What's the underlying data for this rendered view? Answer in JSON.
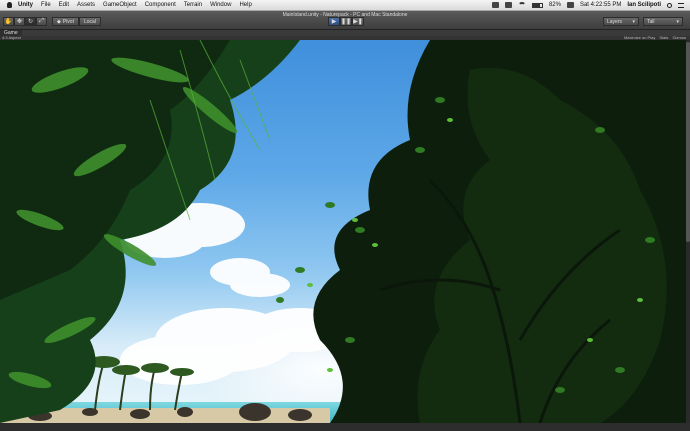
{
  "menubar": {
    "app": "Unity",
    "items": [
      "File",
      "Edit",
      "Assets",
      "GameObject",
      "Component",
      "Terrain",
      "Window",
      "Help"
    ],
    "battery": "82%",
    "clock": "Sat 4:22:55 PM",
    "user": "Ian Scilipoti"
  },
  "window": {
    "title": "MainIsland.unity - Naturepack - PC and Mac Standalone"
  },
  "toolbar": {
    "pivot_label": "Pivot",
    "space_label": "Local",
    "layers_label": "Layers",
    "layout_label": "Tall"
  },
  "game_tab": {
    "label": "Game",
    "aspect": "4:3 Aspect",
    "maximize": "Maximize on Play",
    "stats": "Stats",
    "gizmos": "Gizmos"
  },
  "scene": {
    "sky_top": "#3f8fdc",
    "sky_bottom": "#eaf6fb",
    "foliage_dark": "#0f2a10",
    "foliage_mid": "#1f5a1c",
    "foliage_light": "#4caa2f"
  }
}
